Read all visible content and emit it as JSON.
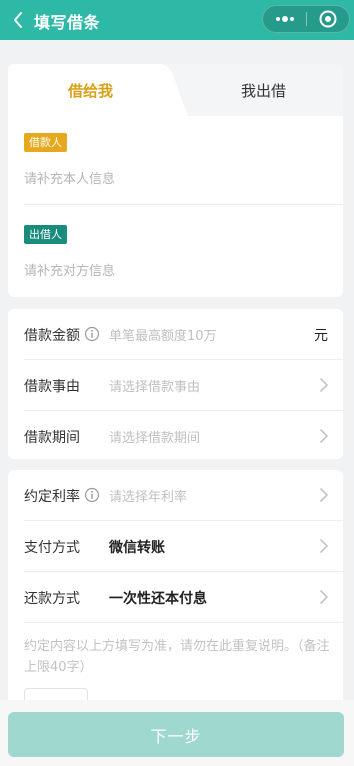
{
  "header": {
    "title": "填写借条",
    "back_icon": "chevron-left-icon",
    "more_icon": "more-dots-icon",
    "close_icon": "target-close-icon"
  },
  "tabs": [
    {
      "label": "借给我",
      "active": true
    },
    {
      "label": "我出借",
      "active": false
    }
  ],
  "parties": {
    "borrower": {
      "badge": "借款人",
      "placeholder": "请补充本人信息"
    },
    "lender": {
      "badge": "出借人",
      "placeholder": "请补充对方信息"
    }
  },
  "loan": {
    "amount": {
      "label": "借款金额",
      "placeholder": "单笔最高额度10万",
      "unit": "元"
    },
    "reason": {
      "label": "借款事由",
      "placeholder": "请选择借款事由"
    },
    "period": {
      "label": "借款期间",
      "placeholder": "请选择借款期间"
    }
  },
  "terms": {
    "rate": {
      "label": "约定利率",
      "placeholder": "请选择年利率"
    },
    "payment": {
      "label": "支付方式",
      "value": "微信转账"
    },
    "repayment": {
      "label": "还款方式",
      "value": "一次性还本付息"
    },
    "note_placeholder": "约定内容以上方填写为准，请勿在此重复说明。（备注上限40字）"
  },
  "footer": {
    "next_label": "下一步"
  },
  "colors": {
    "brand": "#2eb8a6",
    "accent": "#d9a01a",
    "borrower_badge": "#e6a91d",
    "lender_badge": "#1a8c7e",
    "button_disabled": "#9ed8cf"
  }
}
